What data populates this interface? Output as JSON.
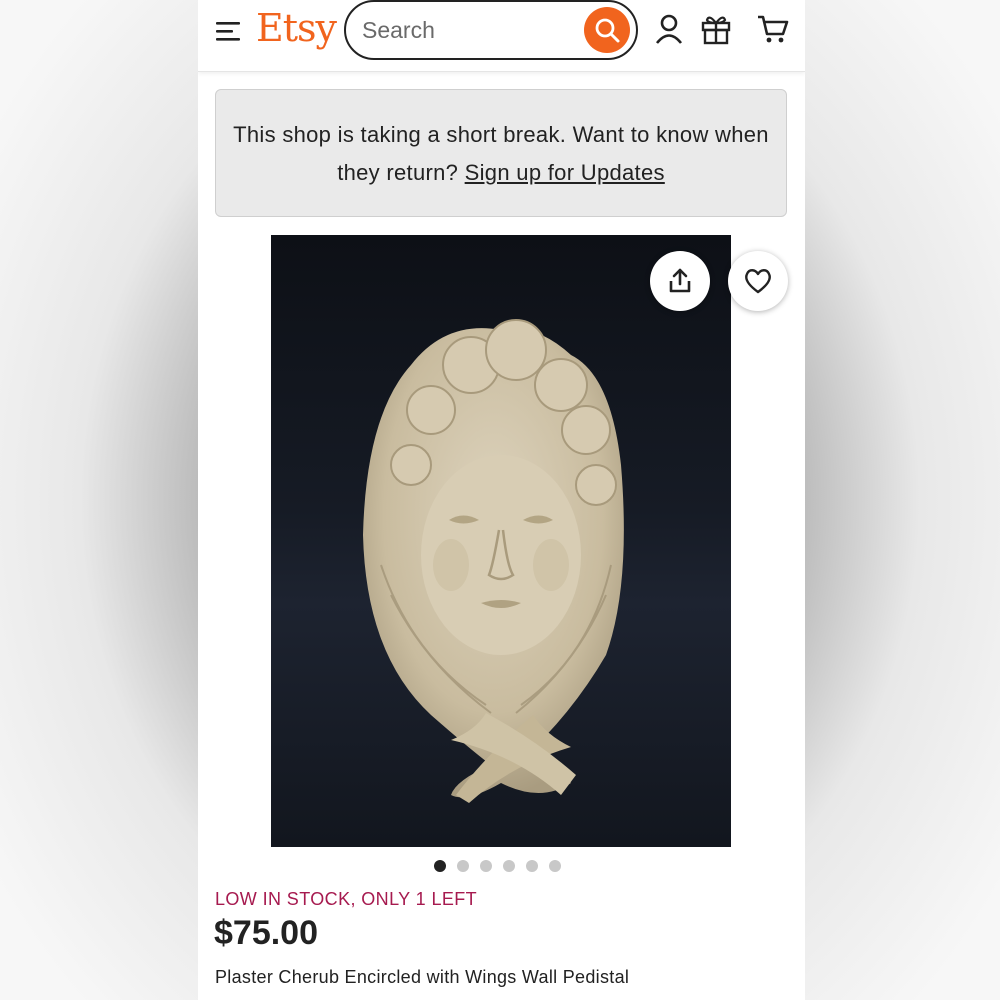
{
  "header": {
    "logo": "Etsy",
    "search_placeholder": "Search",
    "icons": [
      "menu-icon",
      "search-icon",
      "account-icon",
      "gift-icon",
      "cart-icon"
    ]
  },
  "notice": {
    "text": "This shop is taking a short break. Want to know when they return?",
    "link": "Sign up for Updates"
  },
  "gallery": {
    "image_description": "Plaster cherub face encircled with wings on dark background",
    "buttons": [
      "share-icon",
      "heart-icon"
    ],
    "total_images": 6,
    "active_index": 0
  },
  "listing": {
    "stock": "LOW IN STOCK, ONLY 1 LEFT",
    "price": "$75.00",
    "title": "Plaster Cherub Encircled with Wings Wall Pedistal"
  },
  "colors": {
    "brand": "#f1641e",
    "stock": "#a61a4f",
    "text": "#222222"
  }
}
